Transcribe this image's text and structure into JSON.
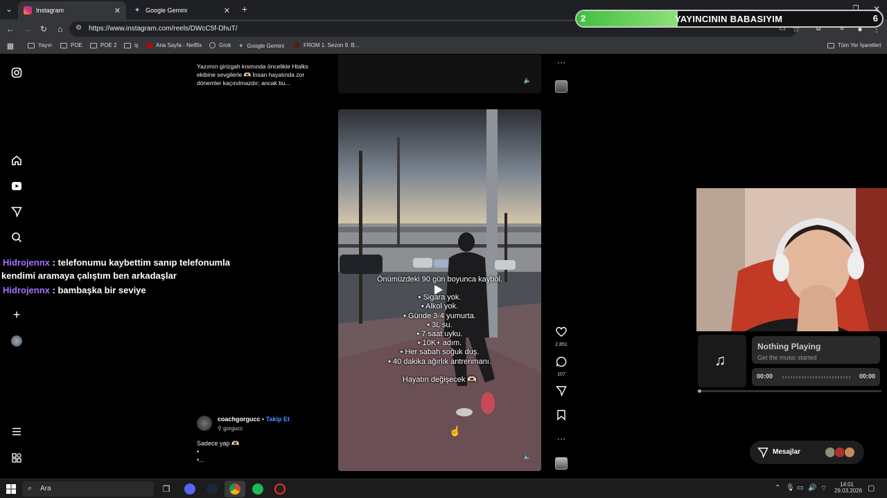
{
  "browser": {
    "tabs": [
      {
        "label": "Instagram",
        "active": true
      },
      {
        "label": "Google Gemini",
        "active": false
      }
    ],
    "new_tab": "+",
    "url": "https://www.instagram.com/reels/DWcC5f-DhuT/",
    "bookmarks": [
      "Yayın",
      "POE",
      "POE 2",
      "iş",
      "Ana Sayfa - Netflix",
      "Grok",
      "Google Gemini",
      "FROM 1. Sezon 9. B..."
    ],
    "all_bookmarks": "Tüm Yer İşaretleri"
  },
  "overlay": {
    "left_value": "2",
    "title": "YAYINCININ BABASIYIM",
    "right_value": "6",
    "progress": 0.33
  },
  "instagram": {
    "prev_caption": "Yazımın girizgah kısmında öncelikle Htalks ekibine sevgilerle 🫶🏻 İnsan hayatında zor dönemler kaçınılmazdır; ancak bu...",
    "reel_overlay_lines": [
      "Önümüzdeki 90 gün boyunca kaybol.",
      "• Sigara yok.",
      "• Alkol yok.",
      "• Günde 3-4 yumurta.",
      "• 3L su.",
      "• 7 saat uyku.",
      "• 10K+ adım.",
      "• Her sabah soğuk duş.",
      "• 40 dakika ağırlık antrenmanı.",
      "Hayatın değişecek 🫶🏻"
    ],
    "likes": "2.851",
    "comments": "107",
    "author": "coachgorgucc",
    "follow": "Takip Et",
    "audio": "gorgucc",
    "caption_line1": "Sadece yap 🫶🏻",
    "caption_line2": "•",
    "caption_line3": "•..."
  },
  "chat": [
    {
      "user": "Hidrojennx",
      "text": " : telefonumu kaybettim sanıp telefonumla"
    },
    {
      "user": "",
      "text": "kendimi aramaya çalıştım ben arkadaşlar"
    },
    {
      "user": "Hidrojennx",
      "text": " : bambaşka bir seviye"
    }
  ],
  "music": {
    "title": "Nothing Playing",
    "subtitle": "Get the music started",
    "time_left": "00:00",
    "time_right": "00:00"
  },
  "messages": {
    "label": "Mesajlar"
  },
  "taskbar": {
    "search": "Ara",
    "time": "14:01",
    "date": "29.03.2026"
  },
  "colors": {
    "progress_green": "#3fbf3f",
    "chat_user": "#a970ff",
    "follow_blue": "#4a90ff"
  }
}
